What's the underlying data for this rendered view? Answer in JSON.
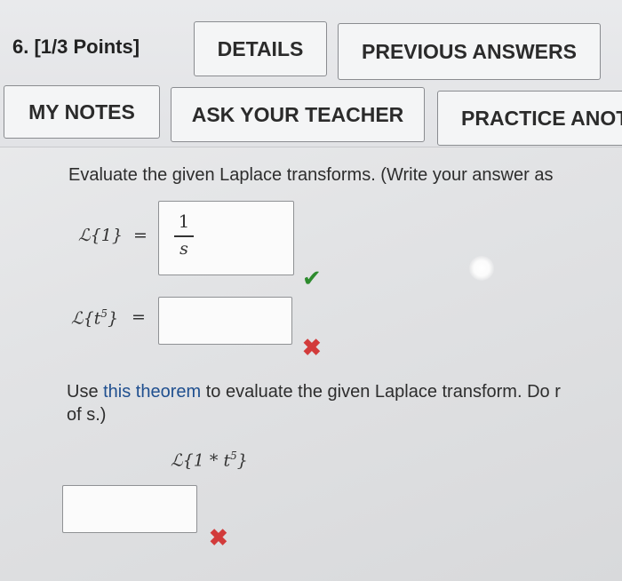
{
  "header": {
    "question_label": "6. [1/3 Points]",
    "details_label": "DETAILS",
    "previous_answers_label": "PREVIOUS ANSWERS",
    "my_notes_label": "MY NOTES",
    "ask_teacher_label": "ASK YOUR TEACHER",
    "practice_label": "PRACTICE ANOT"
  },
  "problem": {
    "instruction": "Evaluate the given Laplace transforms. (Write your answer as",
    "part1": {
      "lhs": "ℒ{1}",
      "equals": "=",
      "answer_num": "1",
      "answer_den": "s",
      "status": "correct"
    },
    "part2": {
      "lhs_prefix": "ℒ{t",
      "lhs_exp": "5",
      "lhs_suffix": "}",
      "equals": "=",
      "answer": "",
      "status": "incorrect"
    },
    "theorem_prefix": "Use ",
    "theorem_link": "this theorem",
    "theorem_suffix": " to evaluate the given Laplace transform. Do r",
    "theorem_line2": "of s.)",
    "part3": {
      "expr_prefix": "ℒ{1 * t",
      "expr_exp": "5",
      "expr_suffix": "}",
      "answer": "",
      "status": "incorrect"
    }
  },
  "icons": {
    "correct": "check-icon",
    "incorrect": "x-icon"
  },
  "colors": {
    "correct": "#2e8b2e",
    "incorrect": "#d23b3b",
    "link": "#1f4f8f"
  }
}
